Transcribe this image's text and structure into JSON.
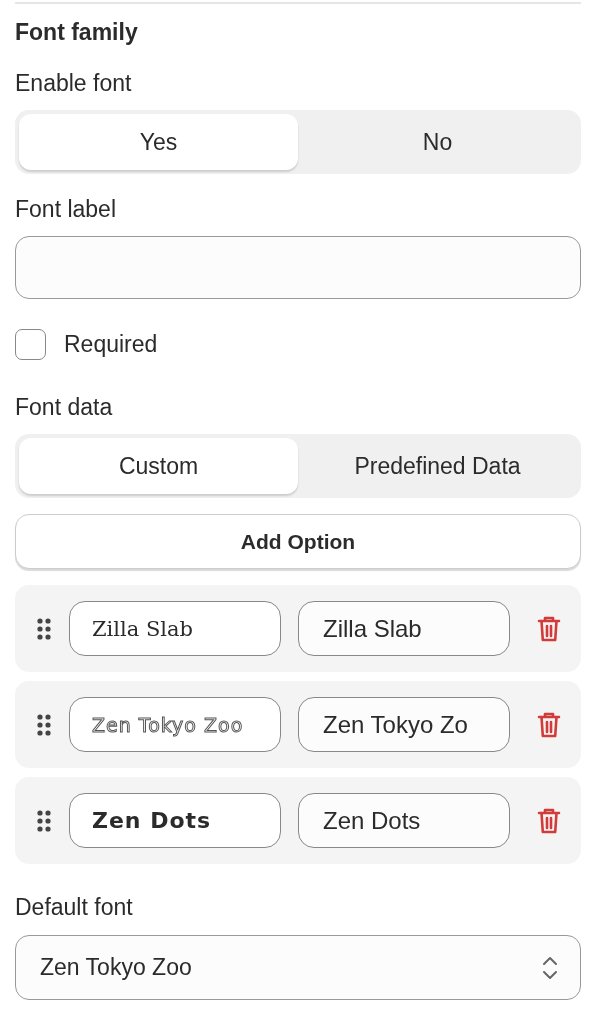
{
  "section_title": "Font family",
  "enable_font": {
    "label": "Enable font",
    "options": [
      {
        "label": "Yes",
        "selected": true
      },
      {
        "label": "No",
        "selected": false
      }
    ]
  },
  "font_label": {
    "label": "Font label"
  },
  "required": {
    "label": "Required",
    "checked": false
  },
  "font_data": {
    "label": "Font data",
    "options": [
      {
        "label": "Custom",
        "selected": true
      },
      {
        "label": "Predefined Data",
        "selected": false
      }
    ]
  },
  "add_option": "Add Option",
  "options": [
    {
      "kind": "serif",
      "preview": "Zilla Slab",
      "value": "Zilla Slab"
    },
    {
      "kind": "striped",
      "preview": "Zen Tokyo Zoo",
      "value": "Zen Tokyo Zo"
    },
    {
      "kind": "heavy",
      "preview": "Zen Dots",
      "value": "Zen Dots"
    }
  ],
  "default_font": {
    "label": "Default font",
    "value": "Zen Tokyo Zoo"
  }
}
